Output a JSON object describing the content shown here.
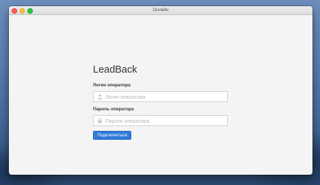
{
  "window": {
    "title": "Онлайн"
  },
  "form": {
    "logo": "LeadBack",
    "login": {
      "label": "Логин оператора",
      "placeholder": "Логин оператора",
      "value": "",
      "icon": "user-icon"
    },
    "password": {
      "label": "Пароль оператора",
      "placeholder": "Пароль оператора",
      "value": "",
      "icon": "lock-icon"
    },
    "submit_label": "Подключиться"
  },
  "colors": {
    "accent": "#2f7ad8",
    "window_bg": "#f4f4f4"
  }
}
